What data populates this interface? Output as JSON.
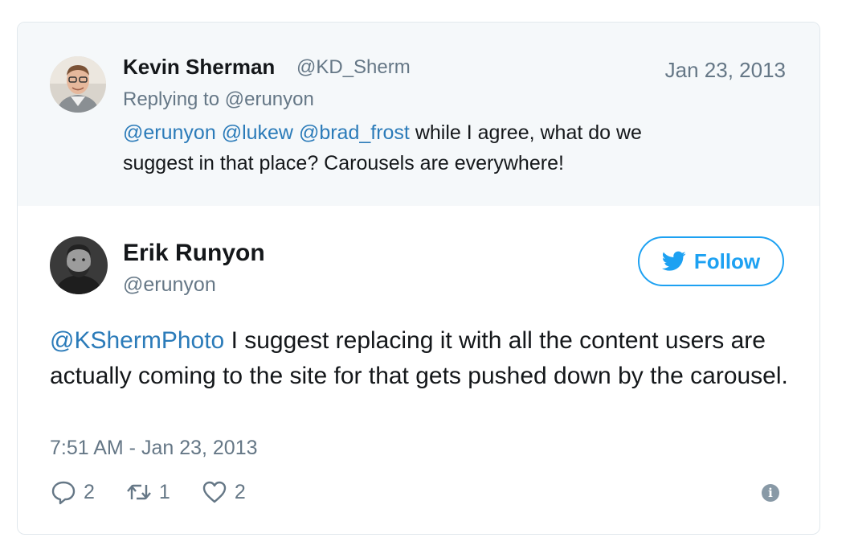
{
  "parent_tweet": {
    "name": "Kevin Sherman",
    "handle": "@KD_Sherm",
    "date": "Jan 23, 2013",
    "replying_to": "Replying to @erunyon",
    "mentions": [
      "@erunyon",
      "@lukew",
      "@brad_frost"
    ],
    "text_line1_rest": "while I agree, what do we",
    "text_line2": "suggest in that place? Carousels are everywhere!"
  },
  "main_tweet": {
    "name": "Erik Runyon",
    "handle": "@erunyon",
    "follow_label": "Follow",
    "mention": "@KShermPhoto",
    "text": "I suggest replacing it with all the content users are actually coming to the site for that gets pushed down by the carousel.",
    "timestamp": "7:51 AM - Jan 23, 2013",
    "reply_count": "2",
    "retweet_count": "1",
    "like_count": "2"
  },
  "icons": {
    "reply": "reply-icon",
    "retweet": "retweet-icon",
    "like": "heart-icon",
    "info": "info-icon",
    "follow": "twitter-bird-icon"
  },
  "colors": {
    "link": "#2b7bb9",
    "twitter_blue": "#1da1f2",
    "muted": "#657786",
    "parent_bg": "#f5f8fa"
  }
}
